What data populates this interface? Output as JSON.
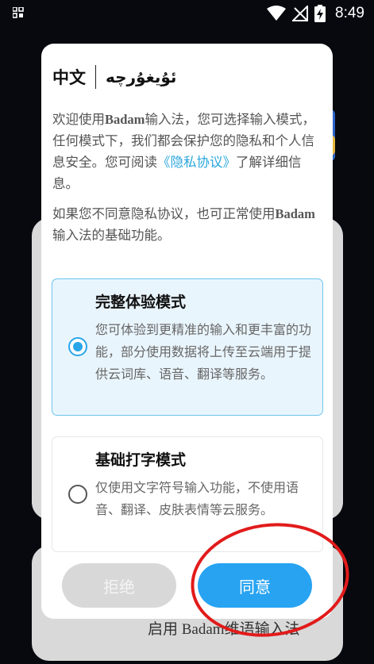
{
  "status_bar": {
    "time": "8:49"
  },
  "background": {
    "enable_label": "启用  Badam维语输入法"
  },
  "dialog": {
    "lang_zh": "中文",
    "lang_ug": "ئۇيغۇرچە",
    "p1_a": "欢迎使用",
    "p1_brand": "Badam",
    "p1_b": "输入法，您可选择输入模式，任何模式下，我们都会保护您的隐私和个人信息安全。您可阅读",
    "p1_link": "《隐私协议》",
    "p1_c": "了解详细信息。",
    "p2_a": "如果您不同意隐私协议，也可正常使用",
    "p2_brand": "Badam",
    "p2_b": "输入法的基础功能。",
    "options": [
      {
        "title": "完整体验模式",
        "desc": "您可体验到更精准的输入和更丰富的功能，部分使用数据将上传至云端用于提供云词库、语音、翻译等服务。",
        "selected": true
      },
      {
        "title": "基础打字模式",
        "desc": "仅使用文字符号输入功能，不使用语音、翻译、皮肤表情等云服务。",
        "selected": false
      }
    ],
    "reject_label": "拒绝",
    "agree_label": "同意"
  },
  "colors": {
    "accent": "#27a3f2",
    "annotation": "#e21b1b"
  }
}
